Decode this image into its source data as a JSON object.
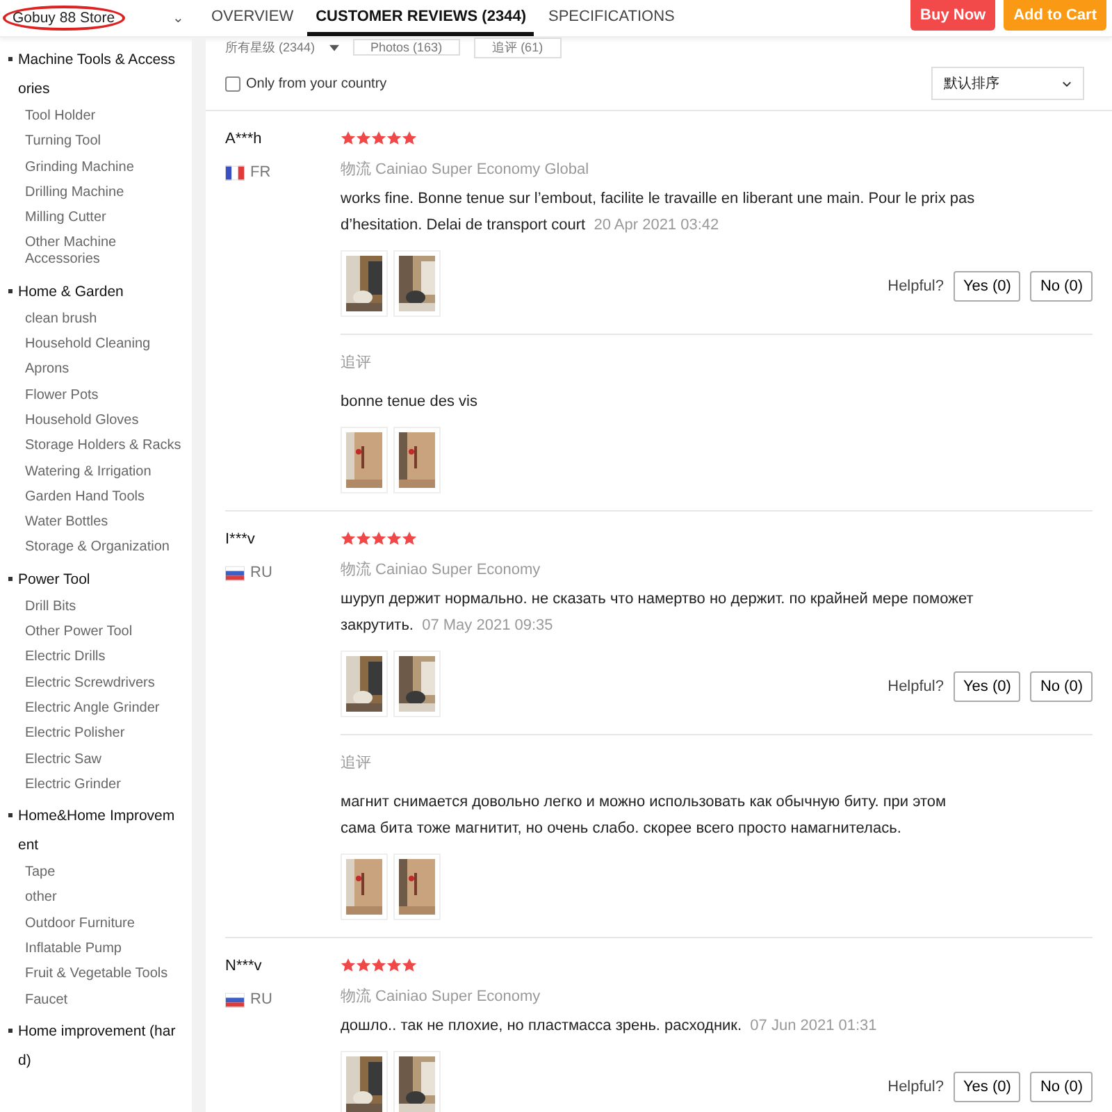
{
  "store": {
    "name": "Gobuy 88 Store",
    "caret": "⌄"
  },
  "tabs": [
    {
      "label": "OVERVIEW",
      "selected": false
    },
    {
      "label": "CUSTOMER REVIEWS (2344)",
      "selected": true
    },
    {
      "label": "SPECIFICATIONS",
      "selected": false
    }
  ],
  "actions": [
    {
      "label": "Buy Now",
      "kind": "buy"
    },
    {
      "label": "Add to Cart",
      "kind": "cart"
    }
  ],
  "sidebar": {
    "categories": [
      {
        "label": "Machine Tools & Accessories",
        "children": [
          {
            "label": "Tool Holder"
          },
          {
            "label": "Turning Tool"
          },
          {
            "label": "Grinding Machine"
          },
          {
            "label": "Drilling Machine"
          },
          {
            "label": "Milling Cutter"
          },
          {
            "label": "Other Machine Accessories"
          }
        ]
      },
      {
        "label": "Home & Garden",
        "children": [
          {
            "label": "clean brush"
          },
          {
            "label": "Household Cleaning"
          },
          {
            "label": "Aprons"
          },
          {
            "label": "Flower Pots"
          },
          {
            "label": "Household Gloves"
          },
          {
            "label": "Storage Holders & Racks"
          },
          {
            "label": "Watering & Irrigation"
          },
          {
            "label": "Garden Hand Tools"
          },
          {
            "label": "Water Bottles"
          },
          {
            "label": "Storage & Organization"
          }
        ]
      },
      {
        "label": "Power Tool",
        "children": [
          {
            "label": "Drill Bits"
          },
          {
            "label": "Other Power Tool"
          },
          {
            "label": "Electric Drills"
          },
          {
            "label": "Electric Screwdrivers"
          },
          {
            "label": "Electric Angle Grinder"
          },
          {
            "label": "Electric Polisher"
          },
          {
            "label": "Electric Saw"
          },
          {
            "label": "Electric Grinder"
          }
        ]
      },
      {
        "label": "Home&Home Improvement",
        "children": [
          {
            "label": "Tape"
          },
          {
            "label": "other"
          },
          {
            "label": "Outdoor Furniture"
          },
          {
            "label": "Inflatable Pump"
          },
          {
            "label": "Fruit & Vegetable Tools"
          },
          {
            "label": "Faucet"
          }
        ]
      },
      {
        "label": "Home improvement (hard)"
      }
    ]
  },
  "filters": {
    "rating": "所有星级 (2344)",
    "chips": [
      "Photos (163)",
      "追评 (61)"
    ],
    "country_only": {
      "label": "Only from your country",
      "checked": false
    },
    "sort": "默认排序"
  },
  "reviews": [
    {
      "name": "A***h",
      "flag": {
        "kind": "fr"
      },
      "country": "FR",
      "stars": 5,
      "logistics_label": "物流",
      "logistics": "Cainiao Super Economy Global",
      "text": "works fine. Bonne tenue sur l’embout, facilite le travaille en liberant une main. Pour le prix pas d’hesitation. Delai de transport court",
      "date": "20 Apr 2021 03:42",
      "photos": [
        {
          "kind": "picture"
        },
        {
          "kind": "picture"
        }
      ],
      "helpful": "Helpful?",
      "yes": "Yes (0)",
      "no": "No (0)",
      "followup": {
        "label": "追评",
        "text": "bonne tenue des vis",
        "photos": [
          {
            "kind": "picture"
          },
          {
            "kind": "picture"
          }
        ]
      }
    },
    {
      "name": "I***v",
      "flag": {
        "kind": "ru"
      },
      "country": "RU",
      "stars": 5,
      "logistics_label": "物流",
      "logistics": "Cainiao Super Economy",
      "text": "шуруп держит нормально. не сказать что намертво но держит. по крайней мере поможет закрутить.",
      "date": "07 May 2021 09:35",
      "photos": [
        {
          "kind": "picture"
        },
        {
          "kind": "picture"
        }
      ],
      "helpful": "Helpful?",
      "yes": "Yes (0)",
      "no": "No (0)",
      "followup": {
        "label": "追评",
        "text": "магнит снимается довольно легко и можно использовать как обычную биту. при этом сама бита тоже магнитит, но очень слабо. скорее всего просто намагнителась.",
        "photos": [
          {
            "kind": "picture"
          },
          {
            "kind": "picture"
          }
        ]
      }
    },
    {
      "name": "N***v",
      "flag": {
        "kind": "ru"
      },
      "country": "RU",
      "stars": 5,
      "logistics_label": "物流",
      "logistics": "Cainiao Super Economy",
      "text": "дошло.. так не плохие, но пластмасса зрень. расходник.",
      "date": "07 Jun 2021 01:31",
      "photos": [
        {
          "kind": "picture"
        },
        {
          "kind": "picture"
        }
      ],
      "helpful": "Helpful?",
      "yes": "Yes (0)",
      "no": "No (0)"
    }
  ]
}
